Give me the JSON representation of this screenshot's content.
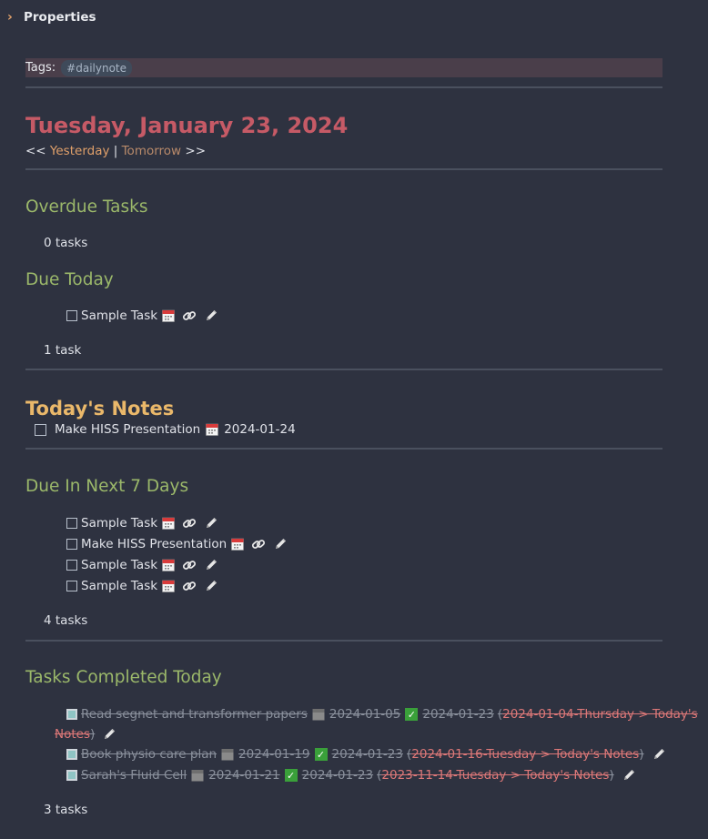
{
  "properties": {
    "label": "Properties"
  },
  "tags": {
    "label": "Tags:",
    "tag": "#dailynote"
  },
  "header": {
    "title": "Tuesday, January 23, 2024",
    "prev_prefix": "<< ",
    "prev": "Yesterday",
    "sep": " | ",
    "next": "Tomorrow",
    "next_suffix": " >>"
  },
  "sections": {
    "overdue": {
      "title": "Overdue Tasks",
      "count": "0 tasks"
    },
    "due_today": {
      "title": "Due Today",
      "tasks": [
        "Sample Task"
      ],
      "count": "1 task"
    },
    "todays_notes": {
      "title": "Today's Notes",
      "task": "Make HISS Presentation",
      "date": "2024-01-24"
    },
    "next7": {
      "title": "Due In Next 7 Days",
      "tasks": [
        "Sample Task",
        "Make HISS Presentation",
        "Sample Task",
        "Sample Task"
      ],
      "count": "4 tasks"
    },
    "completed": {
      "title": "Tasks Completed Today",
      "tasks": [
        {
          "text": "Read segnet and transformer papers",
          "due": "2024-01-05",
          "done": "2024-01-23",
          "link_a": "2024-01-04-Thursday > Today's",
          "link_b": "Notes"
        },
        {
          "text": "Book physio care plan",
          "due": "2024-01-19",
          "done": "2024-01-23",
          "link": "2024-01-16-Tuesday > Today's Notes"
        },
        {
          "text": "Sarah's Fluid Cell",
          "due": "2024-01-21",
          "done": "2024-01-23",
          "link": "2023-11-14-Tuesday > Today's Notes"
        }
      ],
      "count": "3 tasks"
    }
  },
  "icons": {
    "calendar": "calendar-icon",
    "link": "link-icon",
    "edit": "pencil-icon",
    "check": "check-icon"
  },
  "colors": {
    "background": "#2e3240",
    "title": "#c65a66",
    "heading": "#9bb86a",
    "notes_heading": "#eab86a",
    "link": "#e0a06a",
    "strike_link": "#dd7878"
  }
}
